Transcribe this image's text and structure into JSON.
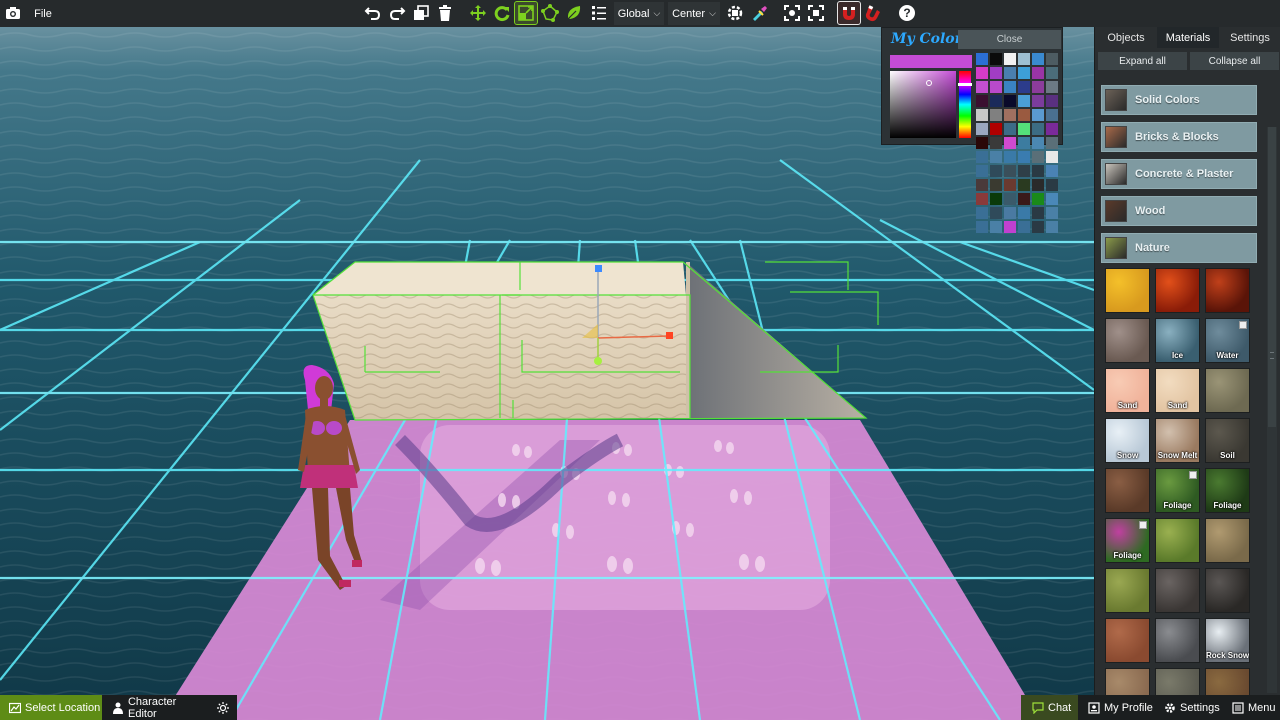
{
  "topbar": {
    "file_label": "File",
    "coord_space": "Global",
    "pivot": "Center"
  },
  "picker": {
    "title": "My Colors",
    "close_label": "Close",
    "selected_color": "#c44cd6",
    "swatches": [
      "#2b6fd6",
      "#0b0b0b",
      "#f2f2f2",
      "#9ec0d2",
      "#3a8ad0",
      "#4d5c62",
      "#d43cc8",
      "#a13dc4",
      "#4a7fae",
      "#3d9fd8",
      "#9a34a6",
      "#4b6d7a",
      "#c24fcf",
      "#b84aca",
      "#3a83c2",
      "#2c3c8c",
      "#8c3c9c",
      "#6c7a84",
      "#3a1030",
      "#1a2a5a",
      "#0a0a2a",
      "#4b9fd6",
      "#7c3c9c",
      "#5a3080",
      "#c8c8c8",
      "#808080",
      "#a07060",
      "#9a5a40",
      "#5a9ad0",
      "#4a7090",
      "#9aa8c0",
      "#b00000",
      "#3c6c88",
      "#54e07a",
      "#3c6c84",
      "#7a2a9a",
      "#2a0808",
      "#3a3a3a",
      "#d04ad0",
      "#3c7ca0",
      "#4b88b2",
      "#5a6f78",
      "#3a6f96",
      "#4a80a6",
      "#3a7aa8",
      "#3a7cb0",
      "#5a6f78",
      "#e8e8e8",
      "#3a6f96",
      "#2f4a5a",
      "#3a4f5a",
      "#2f3f48",
      "#2a3a44",
      "#4a82b4",
      "#4a3a3a",
      "#3a3a30",
      "#6a3a30",
      "#2a3a20",
      "#2a2a2a",
      "#2a3a44",
      "#8a3a3a",
      "#0a3a0a",
      "#3a5a6a",
      "#3a1a1a",
      "#1a8a1a",
      "#4a88b8",
      "#3a6f96",
      "#2f4a5a",
      "#4a7aa2",
      "#3a7aa8",
      "#2a3a44",
      "#4a80a6",
      "#3a6f96",
      "#4a80a6",
      "#c040d0",
      "#3a6f96",
      "#2a3a44",
      "#4a80a6"
    ]
  },
  "panel": {
    "tabs": [
      "Objects",
      "Materials",
      "Settings"
    ],
    "active_tab": "Materials",
    "expand_all": "Expand all",
    "collapse_all": "Collapse all",
    "categories": [
      {
        "label": "Solid Colors",
        "thumb": "#6b6157"
      },
      {
        "label": "Bricks & Blocks",
        "thumb": "#a86a4a"
      },
      {
        "label": "Concrete & Plaster",
        "thumb": "#c9c4bc"
      },
      {
        "label": "Wood",
        "thumb": "#5a3a2a"
      },
      {
        "label": "Nature",
        "thumb": "#8a9a4a"
      }
    ],
    "materials": [
      {
        "label": "",
        "color": "#d89a1e",
        "alt": "#f4c02a",
        "icon": "lava-yellow"
      },
      {
        "label": "",
        "color": "#8a1c08",
        "alt": "#e2501a",
        "icon": "lava-red"
      },
      {
        "label": "",
        "color": "#5a1408",
        "alt": "#c0401a",
        "icon": "lava-dark"
      },
      {
        "label": "",
        "color": "#6a5a52",
        "alt": "#a0908a",
        "icon": "bark"
      },
      {
        "label": "Ice",
        "color": "#3a5f70",
        "alt": "#8ab0c0",
        "icon": "ice"
      },
      {
        "label": "Water",
        "color": "#3e5a6a",
        "alt": "#6f8c9c",
        "icon": "water",
        "corner": true
      },
      {
        "label": "Sand",
        "color": "#f0b29a",
        "alt": "#f8cbb4",
        "icon": "sand-pink"
      },
      {
        "label": "Sand",
        "color": "#e2c4a2",
        "alt": "#f2dcc0",
        "icon": "sand"
      },
      {
        "label": "",
        "color": "#6e6a52",
        "alt": "#9a9476",
        "icon": "gravel"
      },
      {
        "label": "Snow",
        "color": "#b8c8d6",
        "alt": "#e8f0f6",
        "icon": "snow"
      },
      {
        "label": "Snow Melt",
        "color": "#9a7a60",
        "alt": "#d2c0ae",
        "icon": "snow-melt"
      },
      {
        "label": "Soil",
        "color": "#3a3832",
        "alt": "#5c584e",
        "icon": "soil"
      },
      {
        "label": "",
        "color": "#5a3a28",
        "alt": "#8a5e44",
        "icon": "dirt"
      },
      {
        "label": "Foliage",
        "color": "#2e5a22",
        "alt": "#6a9a40",
        "icon": "foliage",
        "corner": true
      },
      {
        "label": "Foliage",
        "color": "#1e3a16",
        "alt": "#4a7a30",
        "icon": "foliage-dark"
      },
      {
        "label": "Foliage",
        "color": "#2e6a22",
        "alt": "#c040a0",
        "icon": "flowers",
        "corner": true
      },
      {
        "label": "",
        "color": "#5a7a2a",
        "alt": "#9ab050",
        "icon": "grass"
      },
      {
        "label": "",
        "color": "#7a6a4a",
        "alt": "#b09a70",
        "icon": "leaves"
      },
      {
        "label": "",
        "color": "#6a7a30",
        "alt": "#9aa852",
        "icon": "moss"
      },
      {
        "label": "",
        "color": "#3a3634",
        "alt": "#6a6462",
        "icon": "rock"
      },
      {
        "label": "",
        "color": "#2a2826",
        "alt": "#5a5654",
        "icon": "slate"
      },
      {
        "label": "",
        "color": "#8a4a30",
        "alt": "#b06a4a",
        "icon": "clay"
      },
      {
        "label": "",
        "color": "#4a4c50",
        "alt": "#8a8c90",
        "icon": "pebbles"
      },
      {
        "label": "Rock Snow",
        "color": "#6a7078",
        "alt": "#e8eef2",
        "icon": "rock-snow"
      },
      {
        "label": "",
        "color": "#8a6a50",
        "alt": "#a88a6a",
        "icon": "mud"
      },
      {
        "label": "",
        "color": "#5a5a50",
        "alt": "#7a7a6a",
        "icon": "stone"
      },
      {
        "label": "",
        "color": "#6a4a30",
        "alt": "#8a6a40",
        "icon": "earth"
      }
    ]
  },
  "bottombar": {
    "select_location": "Select Location",
    "character_editor": "Character Editor",
    "chat": "Chat",
    "my_profile": "My Profile",
    "settings": "Settings",
    "menu": "Menu"
  },
  "colors": {
    "accent_green": "#6ab220",
    "grid_cyan": "#5ff0ff",
    "floor_pink": "#d98ad6",
    "chat_bg": "#5e8c16"
  }
}
